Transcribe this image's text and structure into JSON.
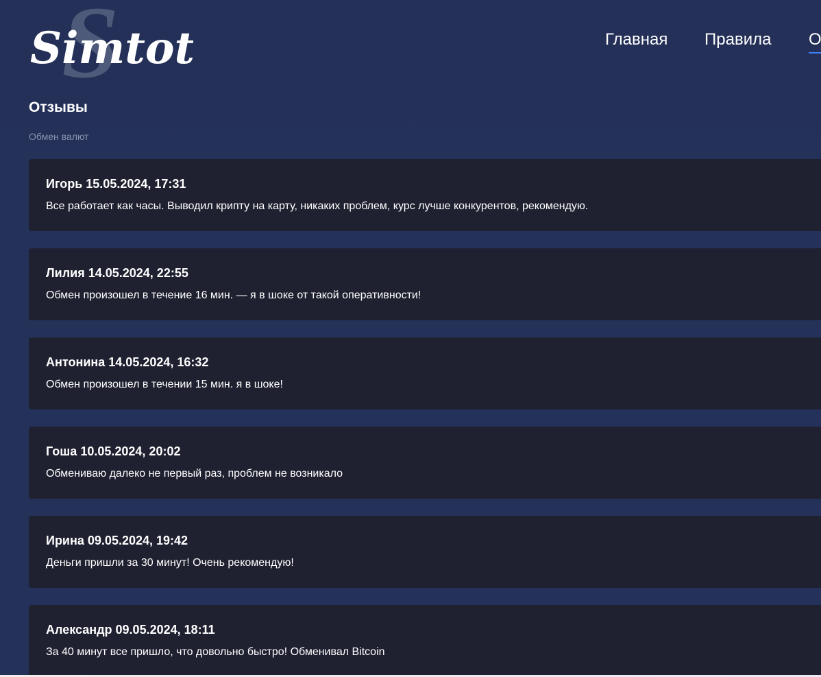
{
  "header": {
    "logo_text": "Simtot",
    "logo_watermark": "S",
    "nav": [
      {
        "label": "Главная",
        "active": false
      },
      {
        "label": "Правила",
        "active": false
      },
      {
        "label": "О",
        "active": true
      }
    ]
  },
  "main": {
    "title": "Отзывы",
    "subtitle": "Обмен валют",
    "reviews": [
      {
        "author": "Игорь",
        "date": "15.05.2024, 17:31",
        "text": "Все работает как часы. Выводил крипту на карту, никаких проблем, курс лучше конкурентов, рекомендую."
      },
      {
        "author": "Лилия",
        "date": "14.05.2024, 22:55",
        "text": "Обмен произошел в течение 16 мин. — я в шоке от такой оперативности!"
      },
      {
        "author": "Антонина",
        "date": "14.05.2024, 16:32",
        "text": "Обмен произошел в течении 15 мин. я в шоке!"
      },
      {
        "author": "Гоша",
        "date": "10.05.2024, 20:02",
        "text": "Обмениваю далеко не первый раз, проблем не возникало"
      },
      {
        "author": "Ирина",
        "date": "09.05.2024, 19:42",
        "text": "Деньги пришли за 30 минут! Очень рекомендую!"
      },
      {
        "author": "Александр",
        "date": "09.05.2024, 18:11",
        "text": "За 40 минут все пришло, что довольно быстро! Обменивал Bitcoin"
      }
    ]
  },
  "colors": {
    "background": "#243057",
    "card": "#1f2131",
    "accent": "#3b82f6",
    "subtitle": "#8893ad"
  }
}
